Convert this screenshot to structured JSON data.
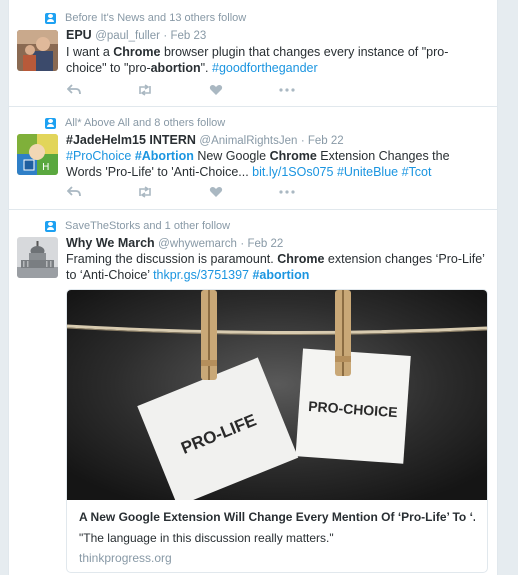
{
  "tweets": [
    {
      "context": "Before It's News and 13 others follow",
      "name": "EPU",
      "handle": "@paul_fuller",
      "date": "· Feb 23",
      "text": {
        "p1": "I want a ",
        "b1": "Chrome",
        "p2": " browser plugin that changes every instance of \"pro-choice\" to \"pro-",
        "b2": "abortion",
        "p3": "\". ",
        "tag": "#goodforthegander"
      }
    },
    {
      "context": "All* Above All and 8 others follow",
      "name": "#JadeHelm15 INTERN",
      "handle": "@AnimalRightsJen",
      "date": "· Feb 22",
      "text": {
        "tag1": "#ProChoice",
        "tag2": "#Abortion",
        "p1": " New Google ",
        "b1": "Chrome",
        "p2": " Extension Changes the Words 'Pro-Life' to 'Anti-Choice... ",
        "link": "bit.ly/1SOs075",
        "tag3": "#UniteBlue",
        "tag4": "#Tcot"
      }
    },
    {
      "context": "SaveTheStorks and 1 other follow",
      "name": "Why We March",
      "handle": "@whywemarch",
      "date": "· Feb 22",
      "text": {
        "p1": "Framing the discussion is paramount. ",
        "b1": "Chrome",
        "p2": " extension changes ‘Pro-Life’ to ‘Anti-Choice’ ",
        "link": "thkpr.gs/3751397",
        "tag": "#abortion"
      },
      "card": {
        "title": "A New Google Extension Will Change Every Mention Of ‘Pro-Life’ To ‘...",
        "description": "\"The language in this discussion really matters.\"",
        "domain": "thinkprogress.org",
        "note_left": "PRO-LIFE",
        "note_right": "PRO-CHOICE"
      }
    }
  ],
  "icons": [
    "person-follow-icon",
    "reply-icon",
    "retweet-icon",
    "like-icon",
    "more-icon"
  ],
  "colors": {
    "link": "#1b95e0",
    "muted": "#8899a6",
    "accent": "#1da1f2",
    "divider": "#e1e8ed"
  }
}
